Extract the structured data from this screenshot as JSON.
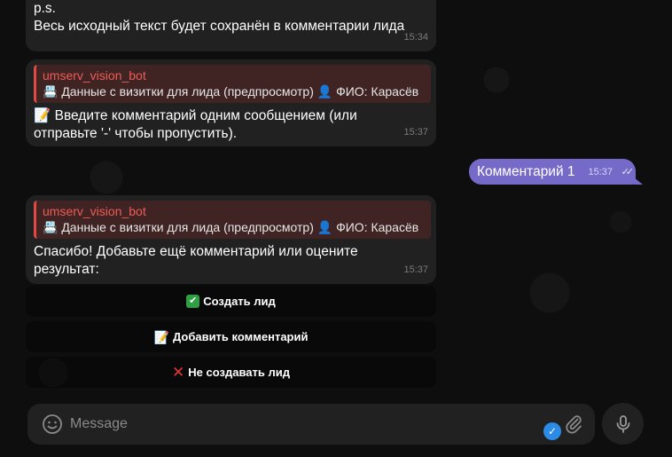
{
  "messages": [
    {
      "text_lines": [
        "p.s.",
        "Весь исходный текст будет сохранён в комментарии лида"
      ],
      "time": "15:34"
    },
    {
      "reply_author": "umserv_vision_bot",
      "reply_preview": "📇 Данные с визитки для лида (предпросмотр) 👤 ФИО: Карасёв",
      "text_lines": [
        "📝 Введите комментарий одним сообщением (или",
        "отправьте '-' чтобы пропустить)."
      ],
      "time": "15:37"
    },
    {
      "reply_author": "umserv_vision_bot",
      "reply_preview": "📇 Данные с визитки для лида (предпросмотр) 👤 ФИО: Карасёв",
      "text_lines": [
        "Спасибо! Добавьте ещё комментарий или оцените",
        "результат:"
      ],
      "time": "15:37"
    }
  ],
  "outgoing": {
    "text": "Комментарий 1",
    "time": "15:37",
    "status": "double-check-read"
  },
  "keyboard": [
    {
      "icon": "check-mark-icon",
      "label": "Создать лид"
    },
    {
      "icon": "memo-icon",
      "label": "Добавить комментарий"
    },
    {
      "icon": "cross-mark-icon",
      "label": "Не создавать лид"
    }
  ],
  "composer": {
    "placeholder": "Message"
  },
  "colors": {
    "outgoing_bubble": "#766ac8",
    "incoming_bubble": "#212121",
    "reply_accent": "#e04a45",
    "background": "#0e0e0e"
  }
}
